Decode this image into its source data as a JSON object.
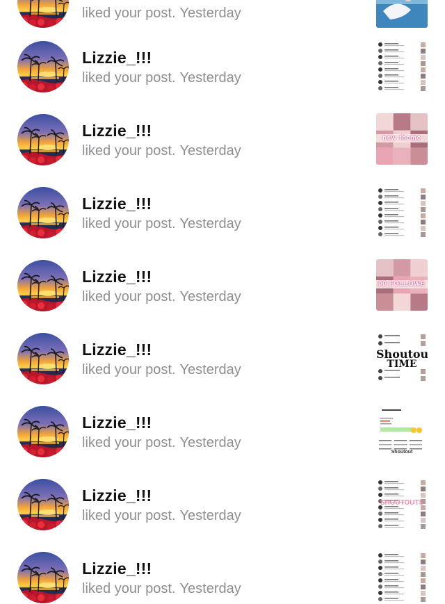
{
  "notifications": [
    {
      "username": "",
      "action": "liked your post.",
      "time": "Yesterday",
      "thumb": "beach-photo"
    },
    {
      "username": "Lizzie_!!!",
      "action": "liked your post.",
      "time": "Yesterday",
      "thumb": "list-collage",
      "thumb_text": ""
    },
    {
      "username": "Lizzie_!!!",
      "action": "liked your post.",
      "time": "Yesterday",
      "thumb": "pink-collage",
      "thumb_text": "new theme"
    },
    {
      "username": "Lizzie_!!!",
      "action": "liked your post.",
      "time": "Yesterday",
      "thumb": "list-collage",
      "thumb_text": ""
    },
    {
      "username": "Lizzie_!!!",
      "action": "liked your post.",
      "time": "Yesterday",
      "thumb": "pink-collage",
      "thumb_text": "00 FOLLOWE"
    },
    {
      "username": "Lizzie_!!!",
      "action": "liked your post.",
      "time": "Yesterday",
      "thumb": "shoutout",
      "thumb_text": "Shoutout",
      "thumb_text2": "TIME"
    },
    {
      "username": "Lizzie_!!!",
      "action": "liked your post.",
      "time": "Yesterday",
      "thumb": "profile-post",
      "thumb_text": "Shoutout"
    },
    {
      "username": "Lizzie_!!!",
      "action": "liked your post.",
      "time": "Yesterday",
      "thumb": "list-collage",
      "thumb_text": "SHOUTOUTS"
    },
    {
      "username": "Lizzie_!!!",
      "action": "liked your post.",
      "time": "Yesterday",
      "thumb": "list-collage",
      "thumb_text": ""
    }
  ],
  "colors": {
    "username": "#111111",
    "secondary_text": "#8e8e93",
    "background": "#ffffff"
  }
}
